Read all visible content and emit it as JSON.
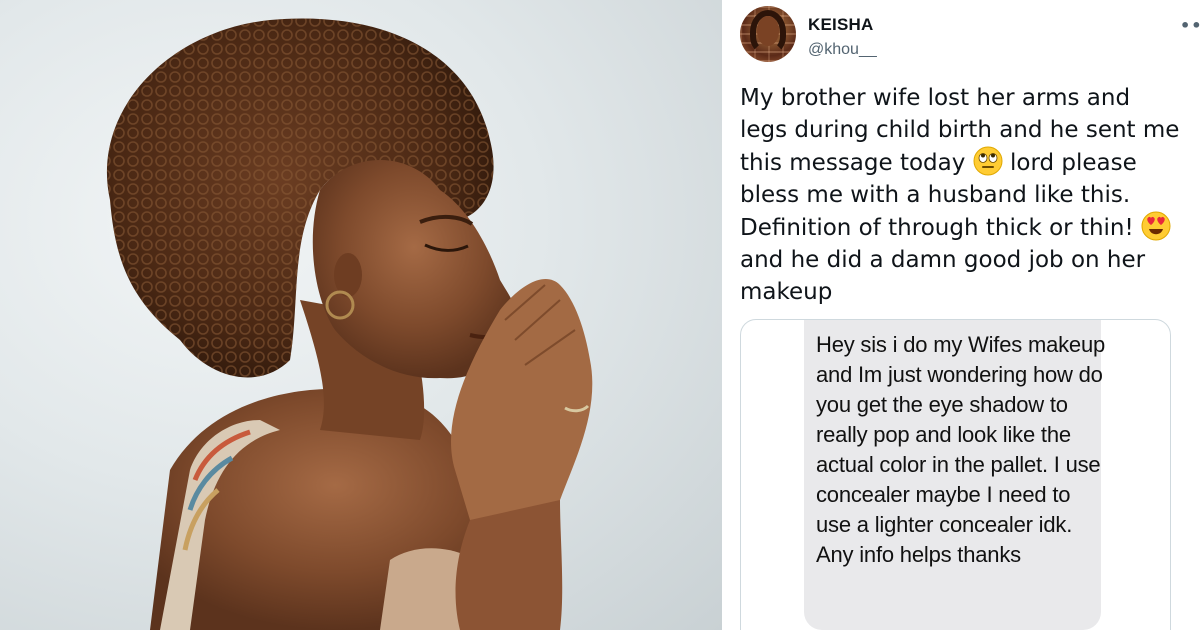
{
  "photo": {
    "subject": "woman-praying"
  },
  "tweet": {
    "author": {
      "display_name": "KEISHA",
      "handle": "@khou__"
    },
    "more_icon": "more-options-icon",
    "text_parts": {
      "p1": "My brother wife lost her arms and legs during child birth and he sent me this message today ",
      "emoji1": "face-with-rolling-eyes",
      "p2": " lord please bless me with a husband like this. Definition of through thick or thin! ",
      "emoji2": "smiling-face-with-heart-eyes",
      "p3": " and he did a damn good job on her makeup"
    },
    "embedded_message": {
      "text": "Hey sis i do my Wifes makeup and Im just wondering how do you get the eye shadow to really pop and look like the actual color in the pallet. I use concealer maybe I need to use a lighter concealer idk. Any info helps thanks"
    }
  }
}
